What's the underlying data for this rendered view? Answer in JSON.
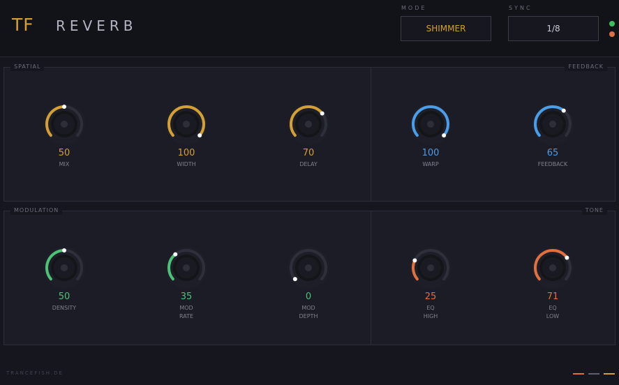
{
  "header": {
    "logo": "TF",
    "title": "REVERB",
    "mode": {
      "label": "MODE",
      "value": "SHIMMER"
    },
    "sync": {
      "label": "SYNC",
      "value": "1/8"
    }
  },
  "sections": {
    "spatial": "SPATIAL",
    "feedback": "FEEDBACK",
    "modulation": "MODULATION",
    "tone": "TONE"
  },
  "knobs": [
    {
      "id": "mix",
      "value": "50",
      "label": "MIX",
      "level": 0.5,
      "color": "#d4a033"
    },
    {
      "id": "width",
      "value": "100",
      "label": "WIDTH",
      "level": 1.0,
      "color": "#d4a033"
    },
    {
      "id": "delay",
      "value": "70",
      "label": "DELAY",
      "level": 0.7,
      "color": "#d4a033"
    },
    {
      "id": "warp",
      "value": "100",
      "label": "WARP",
      "level": 1.0,
      "color": "#4a9de8"
    },
    {
      "id": "feedback",
      "value": "65",
      "label": "FEEDBACK",
      "level": 0.65,
      "color": "#4a9de8"
    },
    {
      "id": "density",
      "value": "50",
      "label": "DENSITY",
      "level": 0.5,
      "color": "#4cc277"
    },
    {
      "id": "mod-rate",
      "value": "35",
      "label": "MOD\nRATE",
      "level": 0.35,
      "color": "#4cc277"
    },
    {
      "id": "mod-depth",
      "value": "0",
      "label": "MOD\nDEPTH",
      "level": 0.0,
      "color": "#4cc277"
    },
    {
      "id": "eq-high",
      "value": "25",
      "label": "EQ\nHIGH",
      "level": 0.25,
      "color": "#e0703f"
    },
    {
      "id": "eq-low",
      "value": "71",
      "label": "EQ\nLOW",
      "level": 0.71,
      "color": "#e0703f"
    }
  ],
  "indicators": {
    "led_top": "#3cc15a",
    "led_bottom": "#e0703f"
  },
  "footer": {
    "text": "TRANCEFISH.DE",
    "lines": [
      "#e0703f",
      "#5c5f6c",
      "#d4a033"
    ]
  }
}
